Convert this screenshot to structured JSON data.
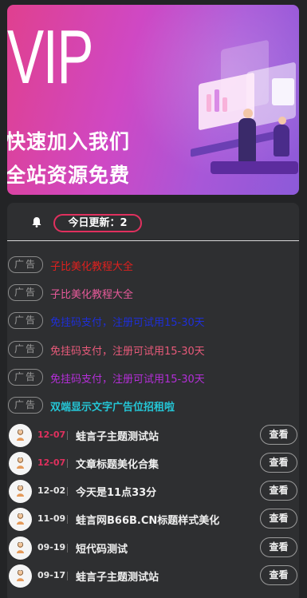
{
  "banner": {
    "big_text": "VIP",
    "line1": "快速加入我们",
    "line2": "全站资源免费"
  },
  "update": {
    "label": "今日更新：2",
    "bell_icon": "bell-icon"
  },
  "ads": [
    {
      "tag": "广告",
      "text": "子比美化教程大全",
      "color": "#e0201e"
    },
    {
      "tag": "广告",
      "text": "子比美化教程大全",
      "color": "#e85a9a"
    },
    {
      "tag": "广告",
      "text": "免挂码支付，注册可试用15-30天",
      "color": "#1e2fd8"
    },
    {
      "tag": "广告",
      "text": "免挂码支付，注册可试用15-30天",
      "color": "#e85a7a"
    },
    {
      "tag": "广告",
      "text": "免挂码支付，注册可试用15-30天",
      "color": "#b42fd8"
    },
    {
      "tag": "广告",
      "text": "双端显示文字广告位招租啦",
      "color": "#24c6d6"
    }
  ],
  "posts": [
    {
      "date": "12-07",
      "title": "蛙言子主题测试站",
      "button": "查看",
      "date_red": true
    },
    {
      "date": "12-07",
      "title": "文章标题美化合集",
      "button": "查看",
      "date_red": true
    },
    {
      "date": "12-02",
      "title": "今天是11点33分",
      "button": "查看",
      "date_red": false
    },
    {
      "date": "11-09",
      "title": "蛙言网B66B.CN标题样式美化",
      "button": "查看",
      "date_red": false
    },
    {
      "date": "09-19",
      "title": "短代码测试",
      "button": "查看",
      "date_red": false
    },
    {
      "date": "09-17",
      "title": "蛙言子主题测试站",
      "button": "查看",
      "date_red": false
    }
  ]
}
